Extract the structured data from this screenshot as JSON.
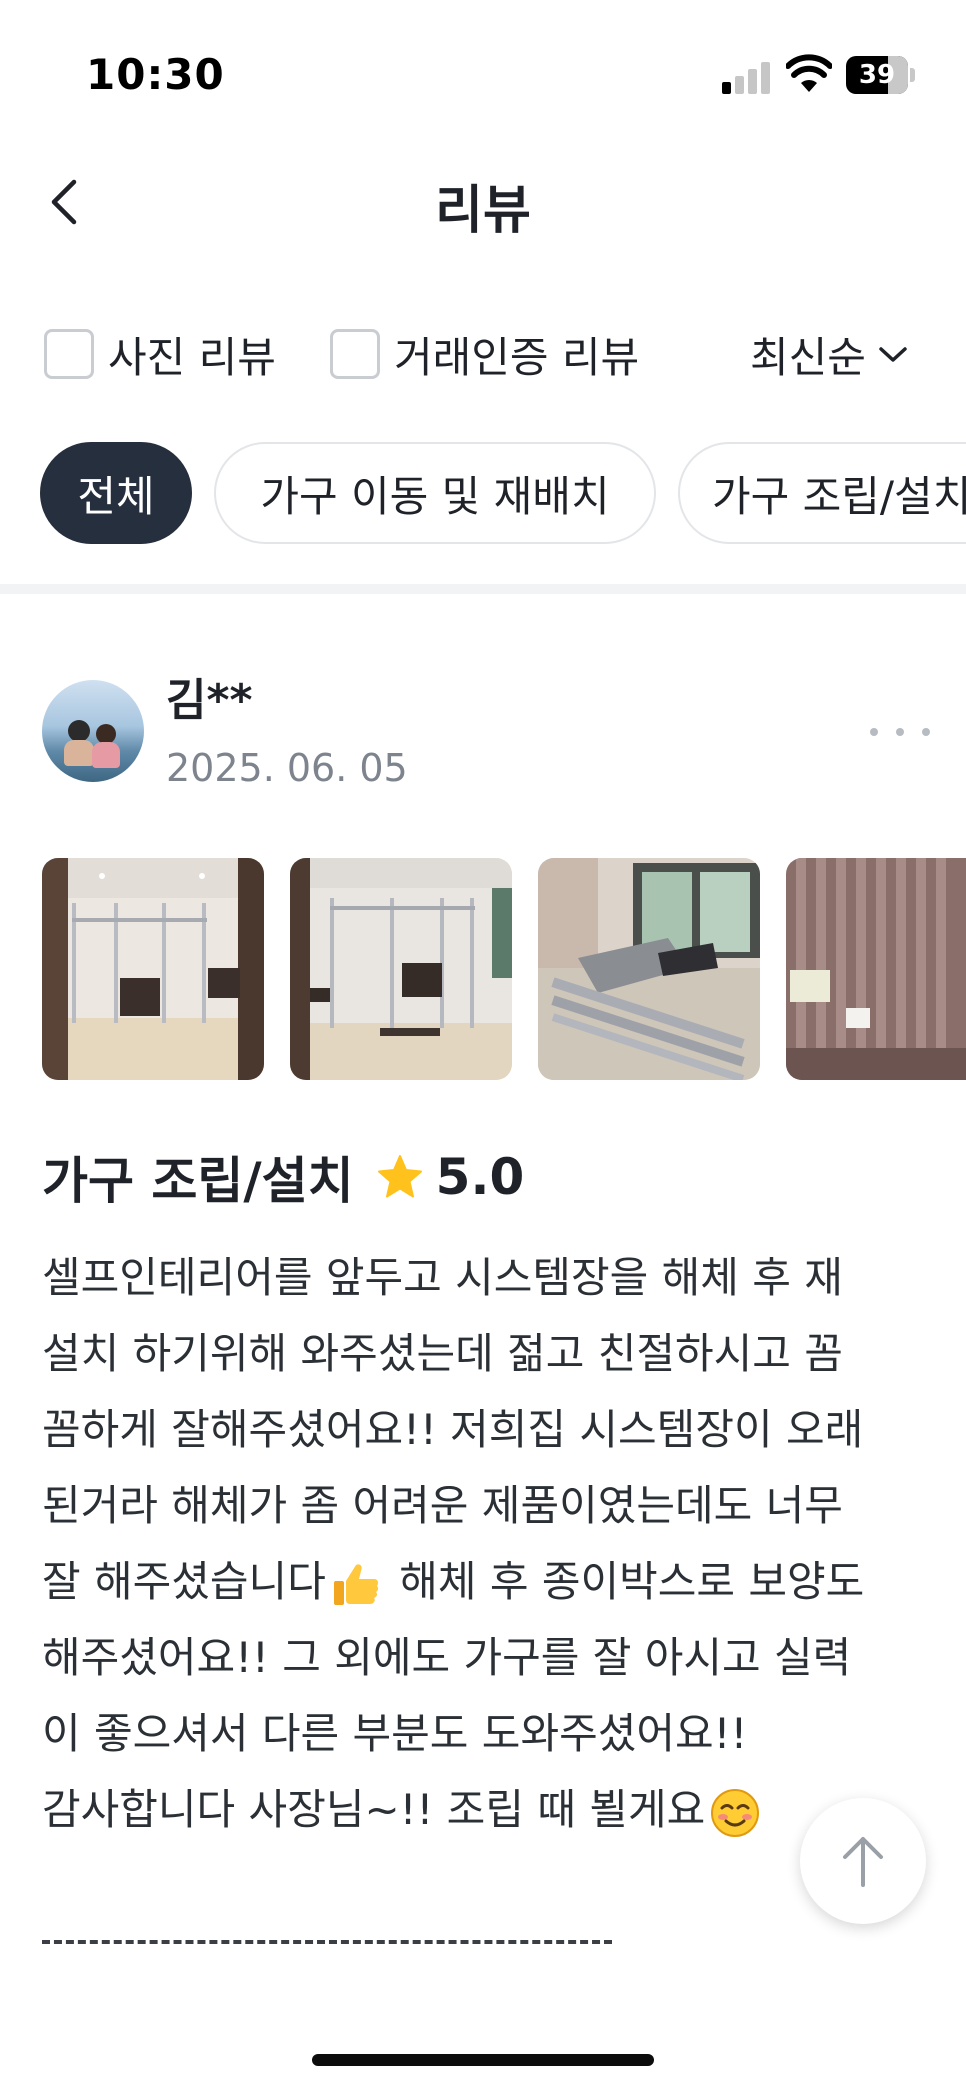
{
  "status_bar": {
    "time": "10:30",
    "battery": "39"
  },
  "header": {
    "title": "리뷰"
  },
  "filters": {
    "photo_review": "사진 리뷰",
    "verified_review": "거래인증 리뷰",
    "sort": "최신순"
  },
  "chips": [
    "전체",
    "가구 이동 및 재배치",
    "가구 조립/설치"
  ],
  "review": {
    "name": "김**",
    "date": "2025. 06. 05",
    "service": "가구 조립/설치",
    "rating": "5.0",
    "lines": [
      "셀프인테리어를 앞두고 시스템장을 해체 후 재",
      "설치 하기위해 와주셨는데 젊고 친절하시고 꼼",
      "꼼하게 잘해주셨어요!! 저희집 시스템장이 오래",
      "된거라 해체가 좀 어려운 제품이였는데도 너무",
      "잘 해주셨습니다",
      " 해체 후 종이박스로 보양도",
      "해주셨어요!! 그 외에도 가구를 잘 아시고 실력",
      "이 좋으셔서 다른 부분도 도와주셨어요!!",
      "감사합니다 사장님~!! 조립 때 뵐게요"
    ],
    "separator": "----------------------------"
  },
  "icons": {
    "back": "chevron-left-icon",
    "sort": "chevron-down-icon",
    "more": "more-dots-icon",
    "star": "star-icon",
    "scroll_top": "arrow-up-icon"
  },
  "colors": {
    "chip_active": "#262f3d",
    "star": "#ffc21c"
  }
}
